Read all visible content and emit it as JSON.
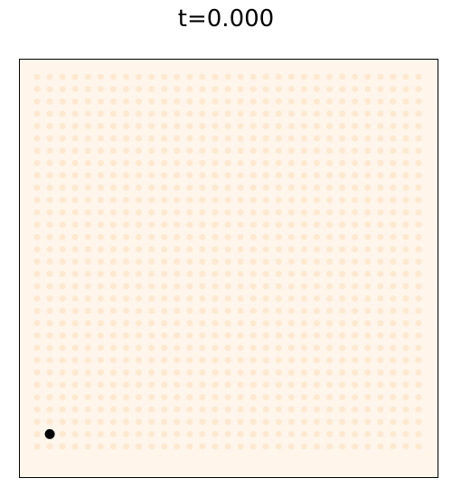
{
  "title": "t=0.000",
  "colors": {
    "background": "#fff5ea",
    "dot": "#fee8cf",
    "marker": "#000000",
    "frame": "#000000"
  },
  "chart_data": {
    "type": "scatter",
    "title": "t=0.000",
    "xlabel": "",
    "ylabel": "",
    "grid": false,
    "axes_ticks": false,
    "lattice": {
      "nx": 31,
      "ny": 31,
      "xlim": [
        0,
        30
      ],
      "ylim": [
        0,
        30
      ],
      "intensity": 0.08
    },
    "marker_point": {
      "x": 1,
      "y": 1
    }
  }
}
